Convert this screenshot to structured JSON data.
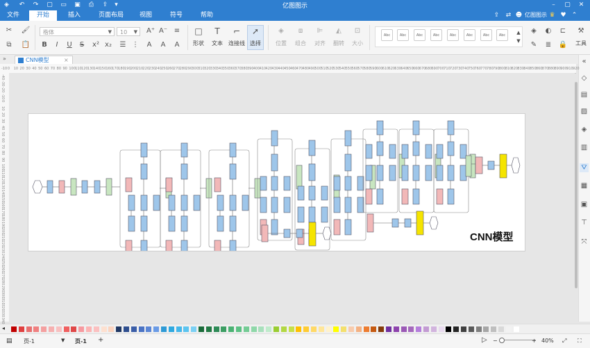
{
  "app": {
    "title": "亿图图示"
  },
  "menu": [
    "文件",
    "开始",
    "插入",
    "页面布局",
    "视图",
    "符号",
    "帮助"
  ],
  "active_menu": "开始",
  "title_bar_right": {
    "user_label": "亿图图示"
  },
  "ribbon": {
    "font_family_placeholder": "楷体",
    "font_size_placeholder": "10",
    "font_buttons": [
      "B",
      "I",
      "U",
      "S",
      "x²",
      "x₂",
      "A",
      "A",
      "A"
    ],
    "tools": {
      "shape": "形状",
      "text": "文本",
      "connector": "连接线",
      "select": "选择"
    },
    "arrange": {
      "position": "位置",
      "group": "组合",
      "align": "对齐",
      "flip": "翻转",
      "size": "大小"
    },
    "style_thumb_label": "Abc",
    "toolbox": "工具"
  },
  "tab": {
    "label": "CNN模型"
  },
  "ruler": {
    "h_ticks": [
      "-10",
      "0",
      "10",
      "20",
      "30",
      "40",
      "50",
      "60",
      "70",
      "80",
      "90",
      "100",
      "110",
      "120",
      "130",
      "140",
      "150",
      "160",
      "170",
      "180",
      "190",
      "200",
      "210",
      "220",
      "230",
      "240",
      "250",
      "260",
      "270",
      "280",
      "290",
      "300",
      "310",
      "320",
      "330",
      "340",
      "350",
      "360",
      "370",
      "380",
      "390",
      "400",
      "410",
      "420",
      "430",
      "440",
      "450",
      "460",
      "470",
      "480",
      "490",
      "500",
      "510",
      "520",
      "530",
      "540",
      "550",
      "560",
      "570",
      "580",
      "590",
      "600",
      "610",
      "620",
      "630",
      "640",
      "650",
      "660",
      "670",
      "680",
      "690",
      "700",
      "710",
      "720",
      "730",
      "740",
      "750",
      "760",
      "770",
      "780",
      "790",
      "800",
      "810",
      "820",
      "830",
      "840",
      "850",
      "860",
      "870",
      "880",
      "890",
      "900",
      "910",
      "920"
    ],
    "v_ticks": [
      "-40",
      "-30",
      "-20",
      "-10",
      "0",
      "10",
      "20",
      "30",
      "40",
      "50",
      "60",
      "70",
      "80",
      "90",
      "100",
      "110",
      "120",
      "130",
      "140",
      "150",
      "160",
      "170",
      "180",
      "190",
      "200",
      "210",
      "220",
      "230",
      "240",
      "250",
      "260",
      "270",
      "280",
      "290",
      "300",
      "310",
      "320",
      "330",
      "340"
    ]
  },
  "diagram": {
    "title": "CNN模型",
    "colors": {
      "blue": "#9ec6ea",
      "pink": "#f2b8b8",
      "green": "#c8e6c0",
      "yellow": "#f5e400",
      "line": "#666666"
    }
  },
  "status": {
    "page_selector": "页-1",
    "page_tab": "页-1",
    "add_page": "+",
    "zoom": "40%"
  },
  "palette": [
    "#c00000",
    "#e04040",
    "#e87070",
    "#f08080",
    "#f4a0a0",
    "#f6b0b0",
    "#f8c0c0",
    "#f06060",
    "#e04848",
    "#f79aa0",
    "#fcb4b4",
    "#fbc0c0",
    "#fde0d0",
    "#fbd4c0",
    "#203864",
    "#2f4f8f",
    "#3b5ea8",
    "#4a73c4",
    "#5b86d6",
    "#6a9be6",
    "#2e9ad6",
    "#2fa9e0",
    "#45b7ea",
    "#5bc4f0",
    "#7bd0f4",
    "#1a6b3a",
    "#237a45",
    "#2e8b57",
    "#3c9e63",
    "#4ab273",
    "#5cc184",
    "#74cc95",
    "#8fd8a9",
    "#a8e0bc",
    "#c0ebcc",
    "#9acd32",
    "#b3d843",
    "#c6e048",
    "#ffc000",
    "#ffcc33",
    "#ffd966",
    "#ffe699",
    "#fff2cc",
    "#ffff00",
    "#f4e06d",
    "#f8cbad",
    "#f4b183",
    "#ed7d31",
    "#c55a11",
    "#843c0c",
    "#7030a0",
    "#8e44ad",
    "#9b59b6",
    "#a569bd",
    "#b57edc",
    "#c39bd3",
    "#d2b4de",
    "#e8daef",
    "#000000",
    "#262626",
    "#404040",
    "#595959",
    "#7f7f7f",
    "#a6a6a6",
    "#bfbfbf",
    "#d9d9d9",
    "#f2f2f2",
    "#ffffff"
  ]
}
